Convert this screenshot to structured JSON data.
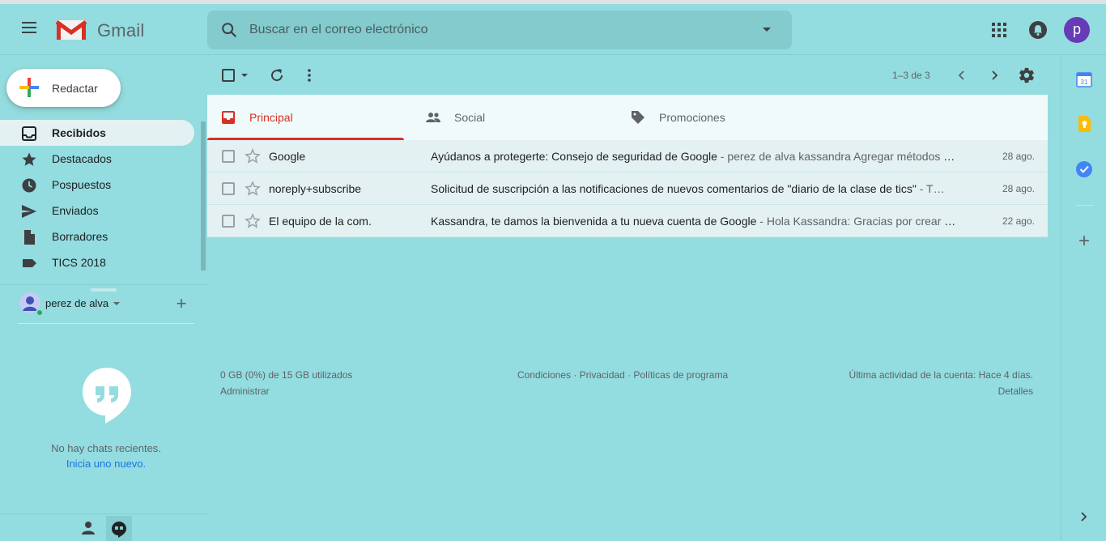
{
  "header": {
    "app_name": "Gmail",
    "search_placeholder": "Buscar en el correo electrónico",
    "avatar_letter": "p"
  },
  "compose": {
    "label": "Redactar"
  },
  "sidebar": {
    "items": [
      {
        "label": "Recibidos",
        "icon": "inbox-icon",
        "active": true
      },
      {
        "label": "Destacados",
        "icon": "star-icon"
      },
      {
        "label": "Pospuestos",
        "icon": "clock-icon"
      },
      {
        "label": "Enviados",
        "icon": "send-icon"
      },
      {
        "label": "Borradores",
        "icon": "draft-icon"
      },
      {
        "label": "TICS 2018",
        "icon": "label-icon"
      }
    ]
  },
  "hangouts": {
    "user_name": "perez de alva",
    "no_chats": "No hay chats recientes.",
    "start_new": "Inicia uno nuevo."
  },
  "toolbar": {
    "page_count": "1–3 de 3"
  },
  "tabs": [
    {
      "label": "Principal",
      "icon": "inbox-icon",
      "active": true
    },
    {
      "label": "Social",
      "icon": "people-icon"
    },
    {
      "label": "Promociones",
      "icon": "tag-icon"
    }
  ],
  "emails": [
    {
      "sender": "Google",
      "subject": "Ayúdanos a protegerte: Consejo de seguridad de Google",
      "snippet": " - perez de alva kassandra Agregar métodos de recuperación…",
      "date": "28 ago."
    },
    {
      "sender": "noreply+subscribe",
      "subject": "Solicitud de suscripción a las notificaciones de nuevos comentarios de \"diario de la clase de tics\"",
      "snippet": " - T…",
      "date": "28 ago."
    },
    {
      "sender": "El equipo de la com.",
      "subject": "Kassandra, te damos la bienvenida a tu nueva cuenta de Google",
      "snippet": " - Hola Kassandra: Gracias por crear una cuenta…",
      "date": "22 ago."
    }
  ],
  "footer": {
    "storage": "0 GB (0%) de 15 GB utilizados",
    "manage": "Administrar",
    "terms": "Condiciones",
    "privacy": "Privacidad",
    "policies": "Políticas de programa",
    "separator": " · ",
    "last_activity": "Última actividad de la cuenta: Hace 4 días.",
    "details": "Detalles"
  },
  "side_panel": {
    "calendar_day": "31"
  },
  "colors": {
    "background": "#93dcdf",
    "accent_red": "#d93025",
    "link_blue": "#1a73e8"
  }
}
